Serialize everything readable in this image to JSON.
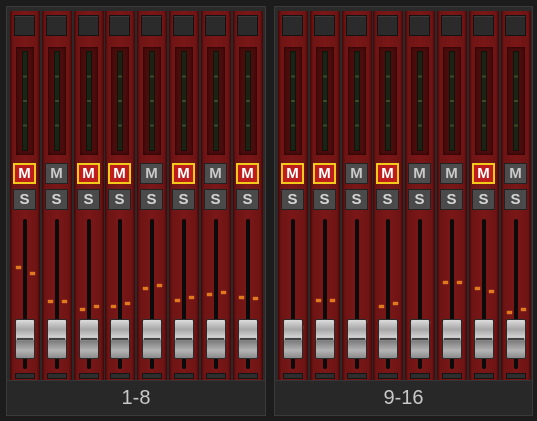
{
  "colors": {
    "strip_red": "#7a1717",
    "mute_on_fill": "#bf1c1c",
    "mute_on_border": "#f2cb1a",
    "volume_mark": "#e0791d",
    "panel": "#2a2a2a"
  },
  "banks": [
    {
      "label": "1-8",
      "channels": [
        {
          "mute_label": "M",
          "solo_label": "S",
          "muted": true,
          "vol_left": 0.69,
          "vol_right": 0.65
        },
        {
          "mute_label": "M",
          "solo_label": "S",
          "muted": false,
          "vol_left": 0.46,
          "vol_right": 0.46
        },
        {
          "mute_label": "M",
          "solo_label": "S",
          "muted": true,
          "vol_left": 0.41,
          "vol_right": 0.43
        },
        {
          "mute_label": "M",
          "solo_label": "S",
          "muted": true,
          "vol_left": 0.43,
          "vol_right": 0.45
        },
        {
          "mute_label": "M",
          "solo_label": "S",
          "muted": false,
          "vol_left": 0.55,
          "vol_right": 0.57
        },
        {
          "mute_label": "M",
          "solo_label": "S",
          "muted": true,
          "vol_left": 0.47,
          "vol_right": 0.49
        },
        {
          "mute_label": "M",
          "solo_label": "S",
          "muted": false,
          "vol_left": 0.51,
          "vol_right": 0.52
        },
        {
          "mute_label": "M",
          "solo_label": "S",
          "muted": true,
          "vol_left": 0.49,
          "vol_right": 0.48
        }
      ]
    },
    {
      "label": "9-16",
      "channels": [
        {
          "mute_label": "M",
          "solo_label": "S",
          "muted": true,
          "vol_left": 0.25,
          "vol_right": 0.29
        },
        {
          "mute_label": "M",
          "solo_label": "S",
          "muted": true,
          "vol_left": 0.47,
          "vol_right": 0.47
        },
        {
          "mute_label": "M",
          "solo_label": "S",
          "muted": false,
          "vol_left": 0.31,
          "vol_right": 0.33
        },
        {
          "mute_label": "M",
          "solo_label": "S",
          "muted": true,
          "vol_left": 0.43,
          "vol_right": 0.45
        },
        {
          "mute_label": "M",
          "solo_label": "S",
          "muted": false,
          "vol_left": 0.32,
          "vol_right": 0.32
        },
        {
          "mute_label": "M",
          "solo_label": "S",
          "muted": false,
          "vol_left": 0.59,
          "vol_right": 0.59
        },
        {
          "mute_label": "M",
          "solo_label": "S",
          "muted": true,
          "vol_left": 0.55,
          "vol_right": 0.53
        },
        {
          "mute_label": "M",
          "solo_label": "S",
          "muted": false,
          "vol_left": 0.39,
          "vol_right": 0.41
        }
      ]
    }
  ]
}
